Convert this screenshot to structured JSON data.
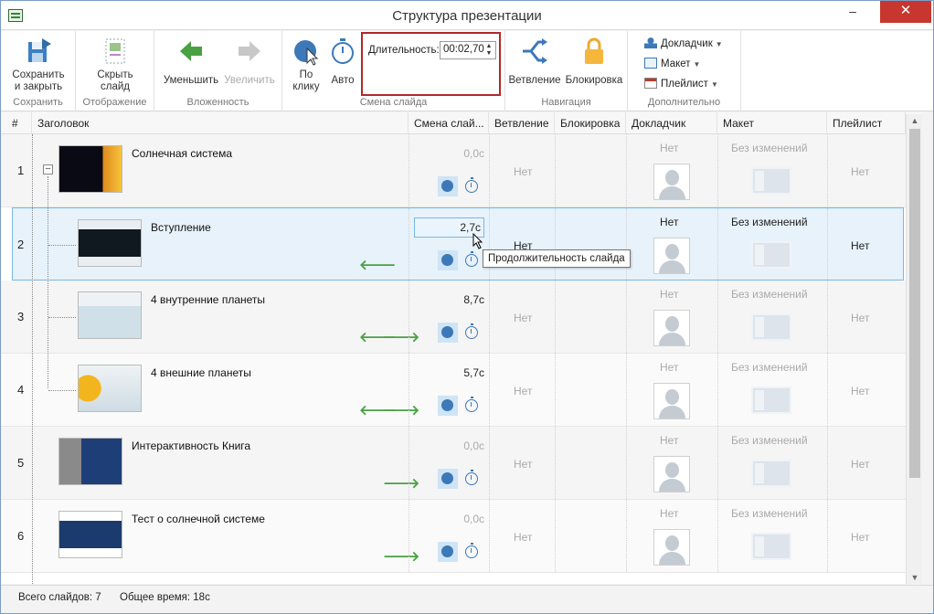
{
  "window": {
    "title": "Структура презентации"
  },
  "ribbon": {
    "save": {
      "label1": "Сохранить",
      "label2": "и закрыть",
      "group": "Сохранить"
    },
    "display": {
      "label1": "Скрыть",
      "label2": "слайд",
      "group": "Отображение"
    },
    "nesting": {
      "decrease": "Уменьшить",
      "increase": "Увеличить",
      "group": "Вложенность"
    },
    "slide_change": {
      "on_click1": "По",
      "on_click2": "клику",
      "auto": "Авто",
      "duration_label": "Длительность:",
      "duration_value": "00:02,70",
      "group": "Смена слайда"
    },
    "navigation": {
      "branching": "Ветвление",
      "lock": "Блокировка",
      "group": "Навигация"
    },
    "extra": {
      "presenter": "Докладчик",
      "layout": "Макет",
      "playlist": "Плейлист",
      "group": "Дополнительно"
    }
  },
  "columns": [
    "#",
    "Заголовок",
    "Смена слай...",
    "Ветвление",
    "Блокировка",
    "Докладчик",
    "Макет",
    "Плейлист"
  ],
  "rows": [
    {
      "num": "1",
      "title": "Солнечная система",
      "time": "0,0с",
      "branch": "Нет",
      "presenter": "Нет",
      "layout": "Без изменений",
      "playlist": "Нет"
    },
    {
      "num": "2",
      "title": "Вступление",
      "time": "2,7с",
      "branch": "Нет",
      "presenter": "Нет",
      "layout": "Без изменений",
      "playlist": "Нет"
    },
    {
      "num": "3",
      "title": "4 внутренние планеты",
      "time": "8,7с",
      "branch": "Нет",
      "presenter": "Нет",
      "layout": "Без изменений",
      "playlist": "Нет"
    },
    {
      "num": "4",
      "title": "4 внешние планеты",
      "time": "5,7с",
      "branch": "Нет",
      "presenter": "Нет",
      "layout": "Без изменений",
      "playlist": "Нет"
    },
    {
      "num": "5",
      "title": "Интерактивность Книга",
      "time": "0,0с",
      "branch": "Нет",
      "presenter": "Нет",
      "layout": "Без изменений",
      "playlist": "Нет"
    },
    {
      "num": "6",
      "title": "Тест о солнечной системе",
      "time": "0,0с",
      "branch": "Нет",
      "presenter": "Нет",
      "layout": "Без изменений",
      "playlist": "Нет"
    }
  ],
  "tooltip": "Продолжительность слайда",
  "status": {
    "total_slides": "Всего слайдов: 7",
    "total_time": "Общее время: 18с"
  },
  "colors": {
    "accent": "#3d78b8",
    "close": "#c7372f",
    "green": "#4aa142",
    "selected_row": "#e7f2fb",
    "highlight_box": "#b0282a"
  }
}
